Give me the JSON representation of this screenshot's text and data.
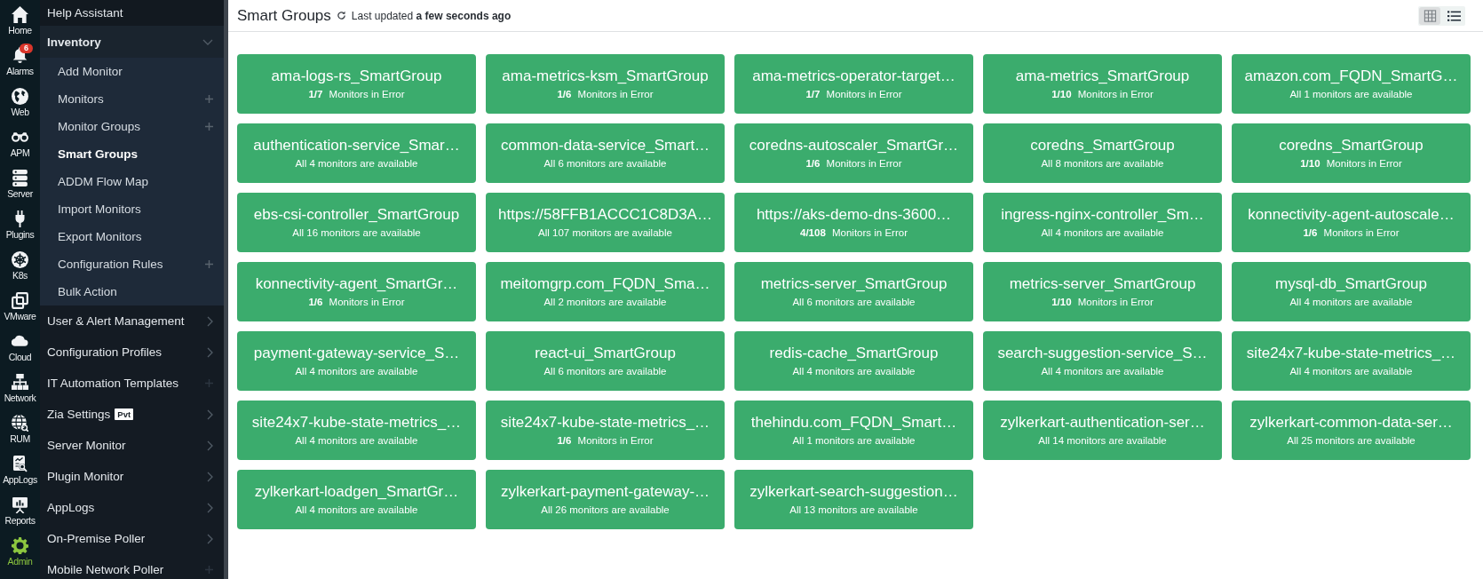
{
  "sidebar": {
    "rail": [
      {
        "kind": "home",
        "label": "Home",
        "selected": false
      },
      {
        "kind": "alarms",
        "label": "Alarms",
        "selected": false,
        "badge": "6"
      },
      {
        "kind": "web",
        "label": "Web",
        "selected": false
      },
      {
        "kind": "apm",
        "label": "APM",
        "selected": false
      },
      {
        "kind": "server",
        "label": "Server",
        "selected": false
      },
      {
        "kind": "plugins",
        "label": "Plugins",
        "selected": false
      },
      {
        "kind": "k8s",
        "label": "K8s",
        "selected": false
      },
      {
        "kind": "vmware",
        "label": "VMware",
        "selected": false
      },
      {
        "kind": "cloud",
        "label": "Cloud",
        "selected": false
      },
      {
        "kind": "network",
        "label": "Network",
        "selected": false
      },
      {
        "kind": "rum",
        "label": "RUM",
        "selected": false
      },
      {
        "kind": "applogs",
        "label": "AppLogs",
        "selected": false
      },
      {
        "kind": "reports",
        "label": "Reports",
        "selected": false
      },
      {
        "kind": "admin",
        "label": "Admin",
        "selected": true
      }
    ],
    "menu": [
      {
        "kind": "link",
        "label": "Help Assistant"
      },
      {
        "kind": "group",
        "label": "Inventory",
        "expanded": true,
        "children": [
          {
            "label": "Add Monitor",
            "selected": false,
            "addable": false
          },
          {
            "label": "Monitors",
            "selected": false,
            "addable": true
          },
          {
            "label": "Monitor Groups",
            "selected": false,
            "addable": true
          },
          {
            "label": "Smart Groups",
            "selected": true,
            "addable": false
          },
          {
            "label": "ADDM Flow Map",
            "selected": false,
            "addable": false
          },
          {
            "label": "Import Monitors",
            "selected": false,
            "addable": false
          },
          {
            "label": "Export Monitors",
            "selected": false,
            "addable": false
          },
          {
            "label": "Configuration Rules",
            "selected": false,
            "addable": true
          },
          {
            "label": "Bulk Action",
            "selected": false,
            "addable": false
          }
        ]
      },
      {
        "kind": "group",
        "label": "User & Alert Management",
        "expanded": false
      },
      {
        "kind": "group",
        "label": "Configuration Profiles",
        "expanded": false
      },
      {
        "kind": "addable",
        "label": "IT Automation Templates"
      },
      {
        "kind": "group",
        "label": "Zia Settings",
        "expanded": false,
        "badge": "Pvt"
      },
      {
        "kind": "group",
        "label": "Server Monitor",
        "expanded": false
      },
      {
        "kind": "group",
        "label": "Plugin Monitor",
        "expanded": false
      },
      {
        "kind": "group",
        "label": "AppLogs",
        "expanded": false
      },
      {
        "kind": "group",
        "label": "On-Premise Poller",
        "expanded": false
      },
      {
        "kind": "addable",
        "label": "Mobile Network Poller"
      }
    ]
  },
  "header": {
    "title": "Smart Groups",
    "updated": "Last updated **a few seconds ago**",
    "view_toggle": [
      {
        "kind": "grid",
        "selected": true
      },
      {
        "kind": "list",
        "selected": false
      }
    ]
  },
  "tiles": [
    {
      "name": "ama-logs-rs_SmartGroup",
      "status": {
        "kind": "error",
        "count": "1/7",
        "text": "Monitors in Error"
      }
    },
    {
      "name": "ama-metrics-ksm_SmartGroup",
      "status": {
        "kind": "error",
        "count": "1/6",
        "text": "Monitors in Error"
      }
    },
    {
      "name": "ama-metrics-operator-target…",
      "status": {
        "kind": "error",
        "count": "1/7",
        "text": "Monitors in Error"
      }
    },
    {
      "name": "ama-metrics_SmartGroup",
      "status": {
        "kind": "error",
        "count": "1/10",
        "text": "Monitors in Error"
      }
    },
    {
      "name": "amazon.com_FQDN_SmartG…",
      "status": {
        "kind": "available",
        "text": "All 1 monitors are available"
      }
    },
    {
      "name": "authentication-service_Smar…",
      "status": {
        "kind": "available",
        "text": "All 4 monitors are available"
      }
    },
    {
      "name": "common-data-service_Smart…",
      "status": {
        "kind": "available",
        "text": "All 6 monitors are available"
      }
    },
    {
      "name": "coredns-autoscaler_SmartGr…",
      "status": {
        "kind": "error",
        "count": "1/6",
        "text": "Monitors in Error"
      }
    },
    {
      "name": "coredns_SmartGroup",
      "status": {
        "kind": "available",
        "text": "All 8 monitors are available"
      }
    },
    {
      "name": "coredns_SmartGroup",
      "status": {
        "kind": "error",
        "count": "1/10",
        "text": "Monitors in Error"
      }
    },
    {
      "name": "ebs-csi-controller_SmartGroup",
      "status": {
        "kind": "available",
        "text": "All 16 monitors are available"
      }
    },
    {
      "name": "https://58FFB1ACCC1C8D3A…",
      "status": {
        "kind": "available",
        "text": "All 107 monitors are available"
      }
    },
    {
      "name": "https://aks-demo-dns-3600…",
      "status": {
        "kind": "error",
        "count": "4/108",
        "text": "Monitors in Error"
      }
    },
    {
      "name": "ingress-nginx-controller_Sm…",
      "status": {
        "kind": "available",
        "text": "All 4 monitors are available"
      }
    },
    {
      "name": "konnectivity-agent-autoscale…",
      "status": {
        "kind": "error",
        "count": "1/6",
        "text": "Monitors in Error"
      }
    },
    {
      "name": "konnectivity-agent_SmartGr…",
      "status": {
        "kind": "error",
        "count": "1/6",
        "text": "Monitors in Error"
      }
    },
    {
      "name": "meitomgrp.com_FQDN_Sma…",
      "status": {
        "kind": "available",
        "text": "All 2 monitors are available"
      }
    },
    {
      "name": "metrics-server_SmartGroup",
      "status": {
        "kind": "available",
        "text": "All 6 monitors are available"
      }
    },
    {
      "name": "metrics-server_SmartGroup",
      "status": {
        "kind": "error",
        "count": "1/10",
        "text": "Monitors in Error"
      }
    },
    {
      "name": "mysql-db_SmartGroup",
      "status": {
        "kind": "available",
        "text": "All 4 monitors are available"
      }
    },
    {
      "name": "payment-gateway-service_S…",
      "status": {
        "kind": "available",
        "text": "All 4 monitors are available"
      }
    },
    {
      "name": "react-ui_SmartGroup",
      "status": {
        "kind": "available",
        "text": "All 6 monitors are available"
      }
    },
    {
      "name": "redis-cache_SmartGroup",
      "status": {
        "kind": "available",
        "text": "All 4 monitors are available"
      }
    },
    {
      "name": "search-suggestion-service_S…",
      "status": {
        "kind": "available",
        "text": "All 4 monitors are available"
      }
    },
    {
      "name": "site24x7-kube-state-metrics_…",
      "status": {
        "kind": "available",
        "text": "All 4 monitors are available"
      }
    },
    {
      "name": "site24x7-kube-state-metrics_…",
      "status": {
        "kind": "available",
        "text": "All 4 monitors are available"
      }
    },
    {
      "name": "site24x7-kube-state-metrics_…",
      "status": {
        "kind": "error",
        "count": "1/6",
        "text": "Monitors in Error"
      }
    },
    {
      "name": "thehindu.com_FQDN_Smart…",
      "status": {
        "kind": "available",
        "text": "All 1 monitors are available"
      }
    },
    {
      "name": "zylkerkart-authentication-ser…",
      "status": {
        "kind": "available",
        "text": "All 14 monitors are available"
      }
    },
    {
      "name": "zylkerkart-common-data-ser…",
      "status": {
        "kind": "available",
        "text": "All 25 monitors are available"
      }
    },
    {
      "name": "zylkerkart-loadgen_SmartGr…",
      "status": {
        "kind": "available",
        "text": "All 4 monitors are available"
      }
    },
    {
      "name": "zylkerkart-payment-gateway-…",
      "status": {
        "kind": "available",
        "text": "All 26 monitors are available"
      }
    },
    {
      "name": "zylkerkart-search-suggestion…",
      "status": {
        "kind": "available",
        "text": "All 13 monitors are available"
      }
    }
  ]
}
